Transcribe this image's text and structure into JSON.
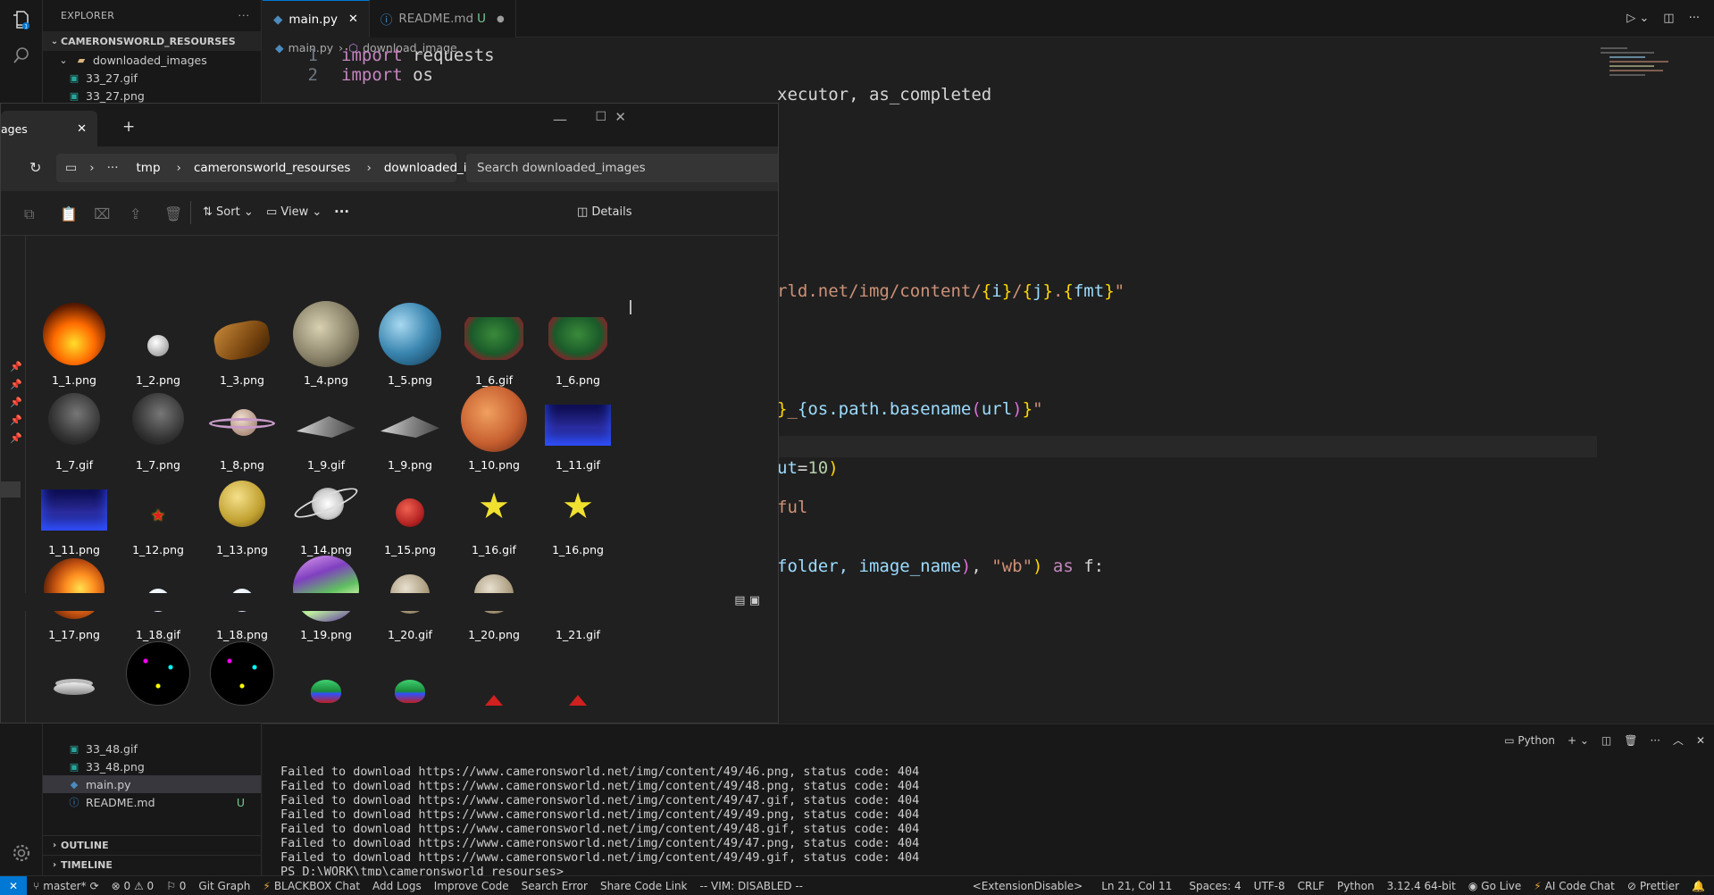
{
  "vscode": {
    "explorer_title": "EXPLORER",
    "explorer_more": "···",
    "section_project": "CAMERONSWORLD_RESOURSES",
    "tree_top": [
      {
        "label": "downloaded_images",
        "icon": "folder-open-icon"
      },
      {
        "label": "33_27.gif",
        "icon": "image-file-icon"
      },
      {
        "label": "33_27.png",
        "icon": "image-file-icon"
      }
    ],
    "tree_bottom": [
      {
        "label": "33_48.gif",
        "icon": "image-file-icon"
      },
      {
        "label": "33_48.png",
        "icon": "image-file-icon"
      },
      {
        "label": "main.py",
        "icon": "python-file-icon"
      },
      {
        "label": "README.md",
        "icon": "info-file-icon",
        "status": "U"
      }
    ],
    "section_outline": "OUTLINE",
    "section_timeline": "TIMELINE",
    "tabs": [
      {
        "label": "main.py",
        "active": true
      },
      {
        "label": "README.md",
        "status": "U",
        "active": false
      }
    ],
    "breadcrumb": [
      "main.py",
      "download_image"
    ],
    "code_line_numbers": [
      "1",
      "2"
    ],
    "code": {
      "l1_kw": "import",
      "l1_mod": " requests",
      "l2_kw": "import",
      "l2_mod": " os",
      "l3": "xecutor, as_completed",
      "l4_a": "rld.net/img/content/",
      "l4_b": "{",
      "l4_c": "i",
      "l4_d": "}",
      "l4_e": "/",
      "l4_f": "{",
      "l4_g": "j",
      "l4_h": "}",
      "l4_i": ".",
      "l4_j": "{",
      "l4_k": "fmt",
      "l4_l": "}",
      "l4_m": "\"",
      "l5_a": "}",
      "l5_b": "_",
      "l5_c": "{os.path.basename",
      "l5_d": "(",
      "l5_e": "url",
      "l5_f": ")",
      "l5_g": "}",
      "l5_h": "\"",
      "l6_a": "ut",
      "l6_b": "=",
      "l6_c": "10",
      "l6_d": ")",
      "l7": "ful",
      "l8_a": "folder, image_name",
      "l8_b": ")",
      "l8_c": ", ",
      "l8_d": "\"wb\"",
      "l8_e": ") ",
      "l8_f": "as",
      "l8_g": " f:"
    },
    "panel": {
      "shell_label": "Python",
      "lines": [
        "Failed to download https://www.cameronsworld.net/img/content/49/46.png, status code: 404",
        "Failed to download https://www.cameronsworld.net/img/content/49/48.png, status code: 404",
        "Failed to download https://www.cameronsworld.net/img/content/49/47.gif, status code: 404",
        "Failed to download https://www.cameronsworld.net/img/content/49/49.png, status code: 404",
        "Failed to download https://www.cameronsworld.net/img/content/49/48.gif, status code: 404",
        "Failed to download https://www.cameronsworld.net/img/content/49/47.png, status code: 404",
        "Failed to download https://www.cameronsworld.net/img/content/49/49.gif, status code: 404",
        "PS D:\\WORK\\tmp\\cameronsworld_resourses>"
      ]
    },
    "status": {
      "branch": "master*",
      "problems": "⊗ 0 ⚠ 0",
      "ports": "⚐ 0",
      "git_graph": "Git Graph",
      "blackbox": "BLACKBOX Chat",
      "add_logs": "Add Logs",
      "improve": "Improve Code",
      "search_error": "Search Error",
      "share": "Share Code Link",
      "vim": "-- VIM: DISABLED --",
      "ext": "<ExtensionDisable>",
      "position": "Ln 21, Col 11",
      "spaces": "Spaces: 4",
      "encoding": "UTF-8",
      "eol": "CRLF",
      "language": "Python",
      "interpreter": "3.12.4 64-bit",
      "golive": "Go Live",
      "ai_chat": "AI Code Chat",
      "prettier": "Prettier"
    }
  },
  "file_explorer": {
    "tab_label": "ages",
    "path": [
      "tmp",
      "cameronsworld_resourses",
      "downloaded_images"
    ],
    "search_placeholder": "Search downloaded_images",
    "sort_label": "Sort",
    "view_label": "View",
    "more_label": "···",
    "details_label": "Details",
    "files": [
      {
        "name": "1_1.png",
        "kind": "lava-planet"
      },
      {
        "name": "1_2.png",
        "kind": "small-moon"
      },
      {
        "name": "1_3.png",
        "kind": "asteroid"
      },
      {
        "name": "1_4.png",
        "kind": "moon"
      },
      {
        "name": "1_5.png",
        "kind": "blue-planet"
      },
      {
        "name": "1_6.gif",
        "kind": "island"
      },
      {
        "name": "1_6.png",
        "kind": "island"
      },
      {
        "name": "1_7.gif",
        "kind": "grey-moon"
      },
      {
        "name": "1_7.png",
        "kind": "grey-moon"
      },
      {
        "name": "1_8.png",
        "kind": "ringed-planet"
      },
      {
        "name": "1_9.gif",
        "kind": "spaceship"
      },
      {
        "name": "1_9.png",
        "kind": "spaceship"
      },
      {
        "name": "1_10.png",
        "kind": "mars"
      },
      {
        "name": "1_11.gif",
        "kind": "night-castle"
      },
      {
        "name": "1_11.png",
        "kind": "night-castle"
      },
      {
        "name": "1_12.png",
        "kind": "red-star"
      },
      {
        "name": "1_13.png",
        "kind": "io"
      },
      {
        "name": "1_14.png",
        "kind": "sketch-saturn"
      },
      {
        "name": "1_15.png",
        "kind": "red-planet"
      },
      {
        "name": "1_16.gif",
        "kind": "yellow-star"
      },
      {
        "name": "1_16.png",
        "kind": "yellow-star"
      },
      {
        "name": "1_17.png",
        "kind": "cutaway-planet"
      },
      {
        "name": "1_18.gif",
        "kind": "white-dot"
      },
      {
        "name": "1_18.png",
        "kind": "white-dot"
      },
      {
        "name": "1_19.png",
        "kind": "swirl-planet"
      },
      {
        "name": "1_20.gif",
        "kind": "comet-moon"
      },
      {
        "name": "1_20.png",
        "kind": "comet-moon"
      },
      {
        "name": "1_21.gif",
        "kind": "ufo"
      },
      {
        "name": "",
        "kind": "ufo"
      },
      {
        "name": "",
        "kind": "fireworks"
      },
      {
        "name": "",
        "kind": "fireworks"
      },
      {
        "name": "",
        "kind": "green-ufo"
      },
      {
        "name": "",
        "kind": "green-ufo"
      },
      {
        "name": "",
        "kind": "red-ship"
      },
      {
        "name": "",
        "kind": "red-ship"
      }
    ]
  }
}
